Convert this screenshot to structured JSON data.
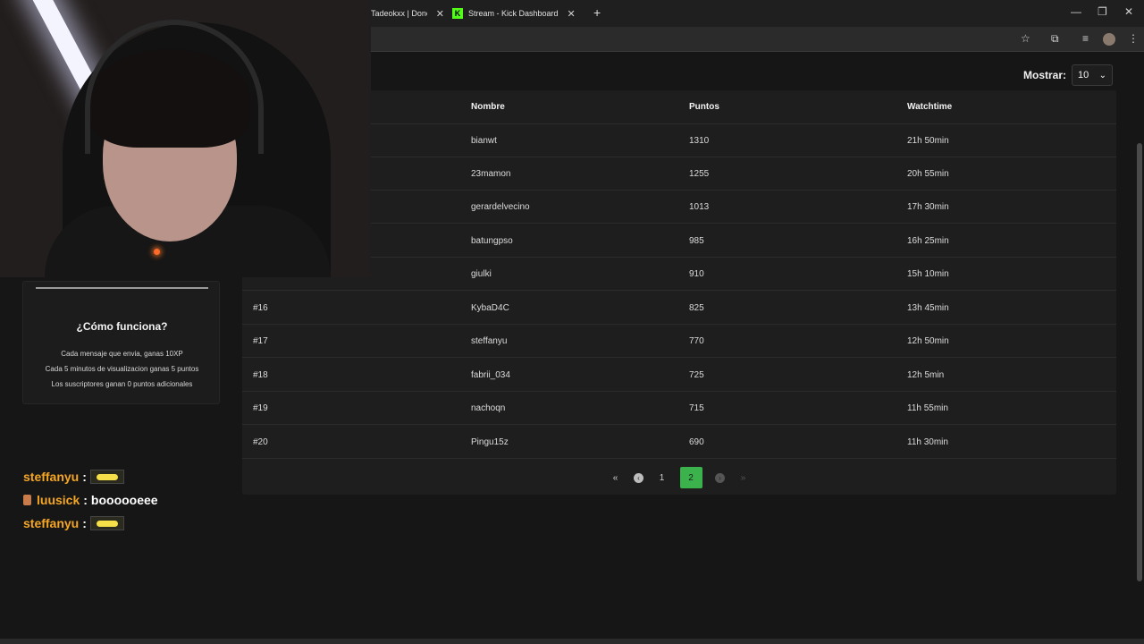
{
  "tabs": [
    {
      "title": "Tadeokxx | Dono",
      "close": "✕"
    },
    {
      "title": "Stream - Kick Dashboard",
      "icon": "kick-logo",
      "close": "✕"
    }
  ],
  "new_tab": "+",
  "window_controls": {
    "minimize": "—",
    "restore": "❐",
    "close": "✕"
  },
  "toolbar_icons": [
    "star-icon",
    "extensions-icon",
    "media-icon",
    "profile-avatar",
    "menu-icon"
  ],
  "mostrar": {
    "label": "Mostrar:",
    "value": "10"
  },
  "table": {
    "headers": {
      "name": "Nombre",
      "points": "Puntos",
      "watchtime": "Watchtime"
    },
    "rows": [
      {
        "rank": "",
        "name": "bianwt",
        "points": "1310",
        "watchtime": "21h 50min"
      },
      {
        "rank": "",
        "name": "23mamon",
        "points": "1255",
        "watchtime": "20h 55min"
      },
      {
        "rank": "",
        "name": "gerardelvecino",
        "points": "1013",
        "watchtime": "17h 30min"
      },
      {
        "rank": "",
        "name": "batungpso",
        "points": "985",
        "watchtime": "16h 25min"
      },
      {
        "rank": "",
        "name": "giulki",
        "points": "910",
        "watchtime": "15h 10min"
      },
      {
        "rank": "#16",
        "name": "KybaD4C",
        "points": "825",
        "watchtime": "13h 45min"
      },
      {
        "rank": "#17",
        "name": "steffanyu",
        "points": "770",
        "watchtime": "12h 50min"
      },
      {
        "rank": "#18",
        "name": "fabrii_034",
        "points": "725",
        "watchtime": "12h 5min"
      },
      {
        "rank": "#19",
        "name": "nachoqn",
        "points": "715",
        "watchtime": "11h 55min"
      },
      {
        "rank": "#20",
        "name": "Pingu15z",
        "points": "690",
        "watchtime": "11h 30min"
      }
    ]
  },
  "pagination": {
    "first": "«",
    "prev": "‹",
    "page1": "1",
    "page2": "2",
    "next": "›",
    "last": "»"
  },
  "howto": {
    "title": "¿Cómo funciona?",
    "lines": [
      "Cada mensaje que envia, ganas 10XP",
      "Cada 5 minutos de visualizacion ganas 5 puntos",
      "Los suscriptores ganan 0 puntos adicionales"
    ]
  },
  "chat": [
    {
      "user": "steffanyu",
      "sep": ":",
      "message": "",
      "emote": "emote"
    },
    {
      "user": "luusick",
      "sep": ":",
      "message": "boooooeee",
      "badge": true
    },
    {
      "user": "steffanyu",
      "sep": ":",
      "message": "",
      "emote": "emote"
    }
  ],
  "colors": {
    "accent": "#3bb24b",
    "chat_user": "#f5a623",
    "kick": "#53fc18"
  }
}
